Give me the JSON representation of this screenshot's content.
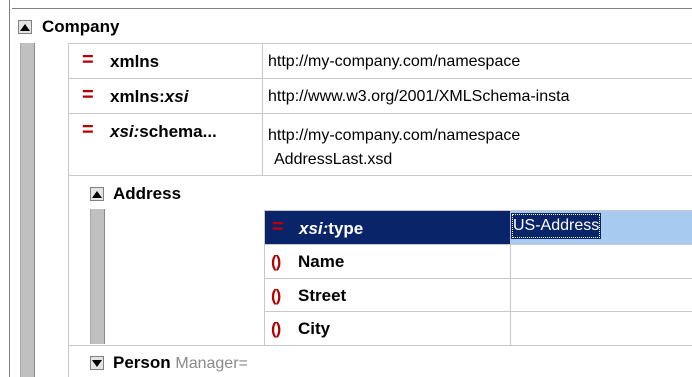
{
  "company": {
    "name": "Company",
    "attributes": [
      {
        "icon": "=",
        "name": "xmlns",
        "value": "http://my-company.com/namespace"
      },
      {
        "icon": "=",
        "name_prefix": "xmlns:",
        "name_italic": "xsi",
        "value": "http://www.w3.org/2001/XMLSchema-insta"
      },
      {
        "icon": "=",
        "name_italic": "xsi:",
        "name_suffix": "schema...",
        "value_line1": "http://my-company.com/namespace",
        "value_line2": "AddressLast.xsd"
      }
    ]
  },
  "address": {
    "name": "Address",
    "attribute": {
      "icon": "=",
      "name_italic": "xsi:",
      "name_suffix": "type",
      "value": "US-Address"
    },
    "children": [
      {
        "icon": "()",
        "name": "Name"
      },
      {
        "icon": "()",
        "name": "Street"
      },
      {
        "icon": "()",
        "name": "City"
      }
    ]
  },
  "person": {
    "name": "Person",
    "hint": "Manager="
  },
  "colors": {
    "selection": "#0a246a",
    "value_highlight": "#a6caf0",
    "icon_red": "#b40000"
  }
}
